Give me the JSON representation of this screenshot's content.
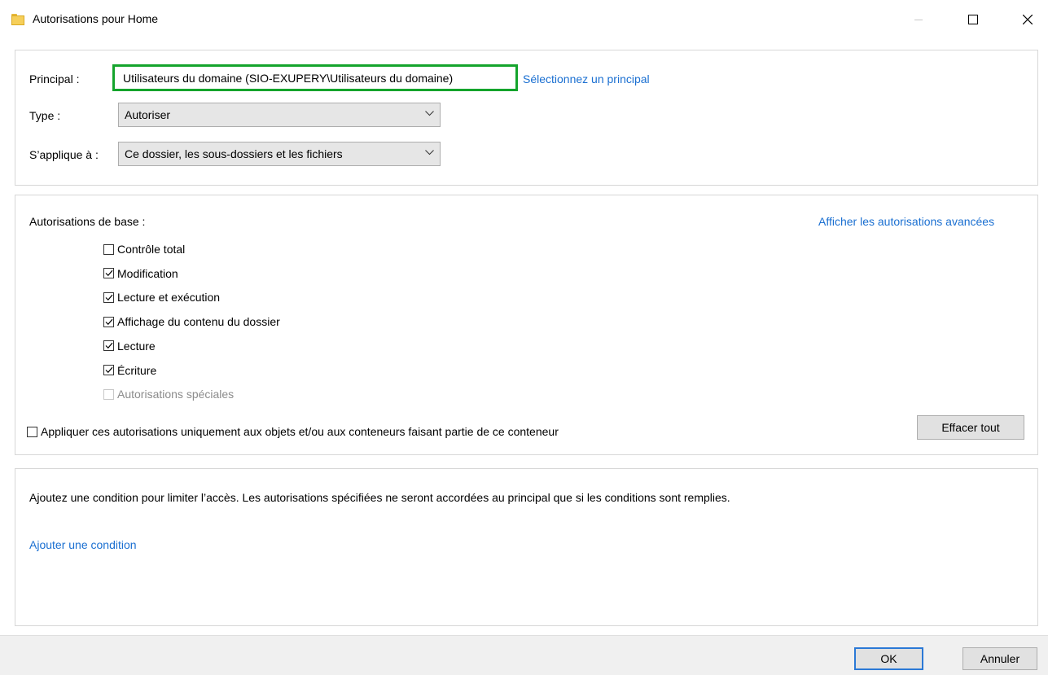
{
  "window": {
    "title": "Autorisations pour Home"
  },
  "principal_section": {
    "principal_label": "Principal :",
    "principal_value": "Utilisateurs du domaine (SIO-EXUPERY\\Utilisateurs du domaine)",
    "select_principal_link": "Sélectionnez un principal",
    "type_label": "Type :",
    "type_value": "Autoriser",
    "applies_label": "S’applique à :",
    "applies_value": "Ce dossier, les sous-dossiers et les fichiers",
    "highlight_color": "#14a42c"
  },
  "permissions_section": {
    "heading": "Autorisations de base :",
    "advanced_link": "Afficher les autorisations avancées",
    "items": [
      {
        "label": "Contrôle total",
        "checked": false,
        "disabled": false
      },
      {
        "label": "Modification",
        "checked": true,
        "disabled": false
      },
      {
        "label": "Lecture et exécution",
        "checked": true,
        "disabled": false
      },
      {
        "label": "Affichage du contenu du dossier",
        "checked": true,
        "disabled": false
      },
      {
        "label": "Lecture",
        "checked": true,
        "disabled": false
      },
      {
        "label": "Écriture",
        "checked": true,
        "disabled": false
      },
      {
        "label": "Autorisations spéciales",
        "checked": false,
        "disabled": true
      }
    ],
    "apply_only_label": "Appliquer ces autorisations uniquement aux objets et/ou aux conteneurs faisant partie de ce conteneur",
    "apply_only_checked": false,
    "clear_all_button": "Effacer tout"
  },
  "condition_section": {
    "description": "Ajoutez une condition pour limiter l’accès. Les autorisations spécifiées ne seront accordées au principal que si les conditions sont remplies.",
    "add_condition_link": "Ajouter une condition"
  },
  "footer": {
    "ok_button": "OK",
    "cancel_button": "Annuler"
  },
  "colors": {
    "link": "#1a6fd1",
    "default_button_border": "#2b79d6"
  }
}
